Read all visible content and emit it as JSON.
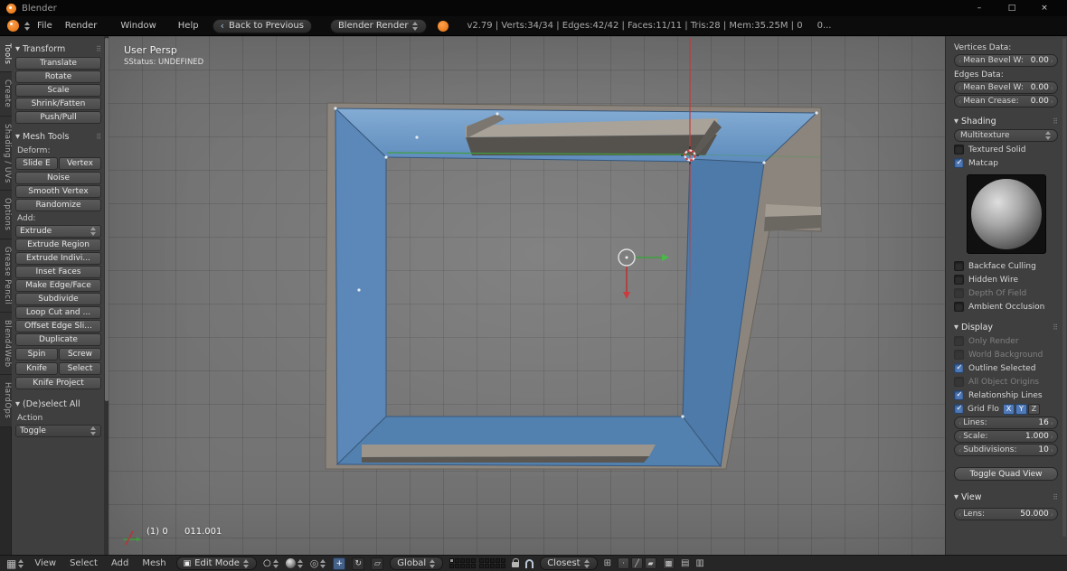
{
  "colors": {
    "accent_blue": "#4f79b7",
    "selected_face_blue": "#5b88b8",
    "axis_red": "#c03a3a",
    "axis_green": "#3f9e3f",
    "logo_orange": "#e87d1e"
  },
  "titlebar": {
    "app_name": "Blender",
    "minimize": "–",
    "maximize": "□",
    "close": "×"
  },
  "infobar": {
    "menus": [
      "File",
      "Render",
      "Window",
      "Help"
    ],
    "back_button": "Back to Previous",
    "engine_dropdown": "Blender Render",
    "stats": "v2.79 | Verts:34/34 | Edges:42/42 | Faces:11/11 | Tris:28 | Mem:35.25M | 0",
    "stats_tail": "0..."
  },
  "left_tabs": [
    {
      "label": "Tools",
      "active": true
    },
    {
      "label": "Create",
      "active": false
    },
    {
      "label": "Shading / UVs",
      "active": false
    },
    {
      "label": "Options",
      "active": false
    },
    {
      "label": "Grease Pencil",
      "active": false
    },
    {
      "label": "Blend4Web",
      "active": false
    },
    {
      "label": "HardOps",
      "active": false
    }
  ],
  "tool_shelf": {
    "transform": {
      "title": "Transform",
      "buttons": [
        "Translate",
        "Rotate",
        "Scale",
        "Shrink/Fatten",
        "Push/Pull"
      ]
    },
    "mesh_tools": {
      "title": "Mesh Tools",
      "deform_label": "Deform:",
      "slide_edge": "Slide E",
      "vertex": "Vertex",
      "deform_buttons": [
        "Noise",
        "Smooth Vertex",
        "Randomize"
      ],
      "add_label": "Add:",
      "extrude": "Extrude",
      "add_buttons": [
        "Extrude Region",
        "Extrude Indivi...",
        "Inset Faces",
        "Make Edge/Face",
        "Subdivide",
        "Loop Cut and ...",
        "Offset Edge Sli...",
        "Duplicate"
      ],
      "spin": "Spin",
      "screw": "Screw",
      "knife": "Knife",
      "select": "Select",
      "knife_project": "Knife Project"
    },
    "deselect_all": {
      "title": "(De)select All",
      "action_label": "Action",
      "toggle_dropdown": "Toggle"
    }
  },
  "viewport": {
    "view_name": "User Persp",
    "status_text": "SStatus: UNDEFINED",
    "footer_counter": "(1) 0",
    "footer_object": "011.001"
  },
  "header_3d": {
    "menus": [
      "View",
      "Select",
      "Add",
      "Mesh"
    ],
    "mode_dropdown": "Edit Mode",
    "orientation_dropdown": "Global",
    "snap_dropdown": "Closest",
    "active_layer": true
  },
  "n_panel": {
    "vertices_data_label": "Vertices Data:",
    "vertices_mean_bevel": {
      "label": "Mean Bevel W:",
      "value": "0.00"
    },
    "edges_data_label": "Edges Data:",
    "edges_mean_bevel": {
      "label": "Mean Bevel W:",
      "value": "0.00"
    },
    "edges_mean_crease": {
      "label": "Mean Crease:",
      "value": "0.00"
    },
    "shading": {
      "title": "Shading",
      "mode_dropdown": "Multitexture",
      "textured_solid": {
        "label": "Textured Solid",
        "checked": false
      },
      "matcap": {
        "label": "Matcap",
        "checked": true
      },
      "backface_culling": {
        "label": "Backface Culling",
        "checked": false
      },
      "hidden_wire": {
        "label": "Hidden Wire",
        "checked": false
      },
      "depth_of_field": {
        "label": "Depth Of Field",
        "checked": false,
        "disabled": true
      },
      "ambient_occlusion": {
        "label": "Ambient Occlusion",
        "checked": false
      }
    },
    "display": {
      "title": "Display",
      "only_render": {
        "label": "Only Render",
        "checked": false,
        "disabled": true
      },
      "world_background": {
        "label": "World Background",
        "checked": false,
        "disabled": true
      },
      "outline_selected": {
        "label": "Outline Selected",
        "checked": true
      },
      "all_object_origins": {
        "label": "All Object Origins",
        "checked": false,
        "disabled": true
      },
      "relationship_lines": {
        "label": "Relationship Lines",
        "checked": true
      },
      "grid_floor": {
        "label": "Grid Flo",
        "checked": true
      },
      "axis_x": {
        "label": "X",
        "active": true
      },
      "axis_y": {
        "label": "Y",
        "active": true
      },
      "axis_z": {
        "label": "Z",
        "active": false
      },
      "lines": {
        "label": "Lines:",
        "value": "16"
      },
      "scale": {
        "label": "Scale:",
        "value": "1.000"
      },
      "subdivisions": {
        "label": "Subdivisions:",
        "value": "10"
      },
      "quad_view_button": "Toggle Quad View"
    },
    "view": {
      "title": "View",
      "lens": {
        "label": "Lens:",
        "value": "50.000"
      }
    }
  },
  "icons": {
    "editor_type": "▦",
    "edit_mode": "▣",
    "proportional": "○",
    "pivot": "◎",
    "manip_translate": "+",
    "manip_rotate": "↻",
    "manip_scale": "▱",
    "select_vertex": "·",
    "select_edge": "╱",
    "select_face": "▰",
    "occlude": "▩",
    "snap_target": "⊞",
    "render_still": "▤",
    "render_anim": "▥",
    "back": "‹"
  }
}
